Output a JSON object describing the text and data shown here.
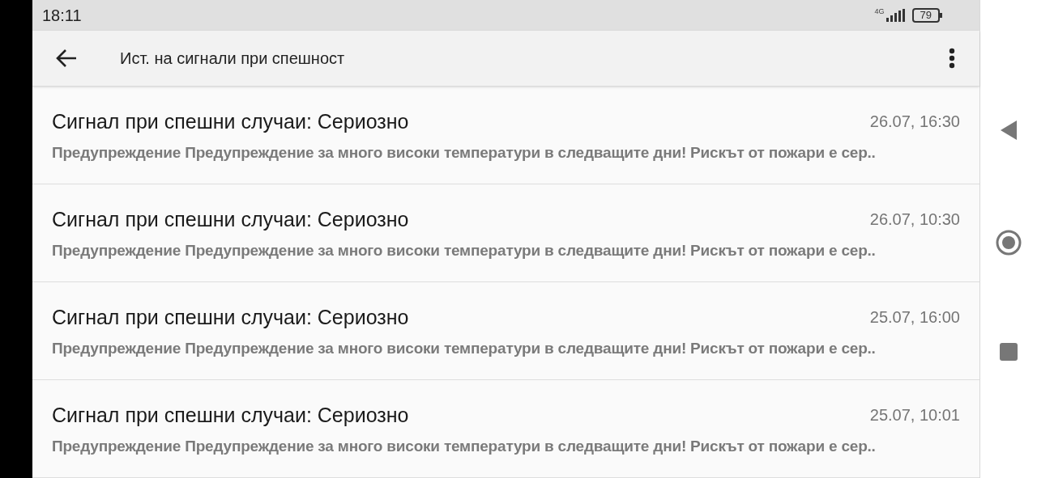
{
  "status_bar": {
    "time": "18:11",
    "network": "4G",
    "battery": "79"
  },
  "app_bar": {
    "title": "Ист. на сигнали при спешност"
  },
  "alerts": [
    {
      "title": "Сигнал при спешни случаи: Сериозно",
      "time": "26.07, 16:30",
      "preview": "Предупреждение Предупреждение за много високи температури в следващите дни! Рискът от пожари е сер.."
    },
    {
      "title": "Сигнал при спешни случаи: Сериозно",
      "time": "26.07, 10:30",
      "preview": "Предупреждение Предупреждение за много високи температури в следващите дни! Рискът от пожари е сер.."
    },
    {
      "title": "Сигнал при спешни случаи: Сериозно",
      "time": "25.07, 16:00",
      "preview": "Предупреждение Предупреждение за много високи температури в следващите дни! Рискът от пожари е сер.."
    },
    {
      "title": "Сигнал при спешни случаи: Сериозно",
      "time": "25.07, 10:01",
      "preview": "Предупреждение Предупреждение за много високи температури в следващите дни! Рискът от пожари е сер.."
    }
  ]
}
